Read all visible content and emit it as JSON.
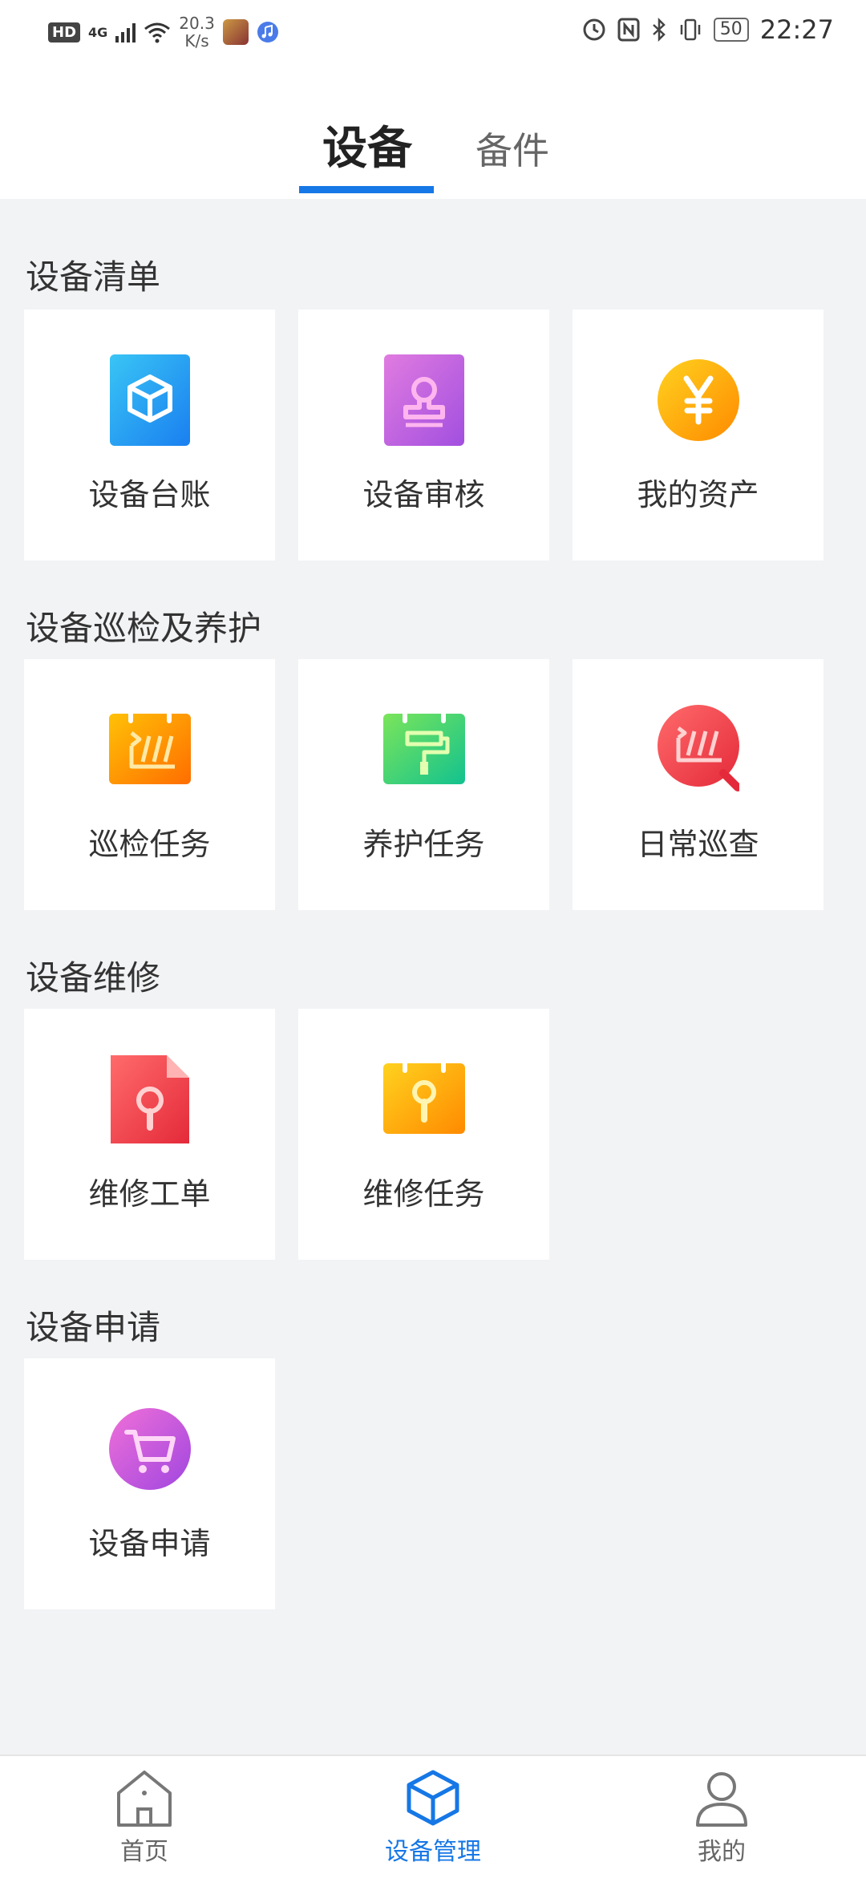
{
  "status_bar": {
    "hd": "HD",
    "network": "4G",
    "speed": "20.3",
    "speed_unit": "K/s",
    "battery": "50",
    "time": "22:27"
  },
  "tabs": [
    {
      "label": "设备",
      "active": true
    },
    {
      "label": "备件",
      "active": false
    }
  ],
  "sections": [
    {
      "title": "设备清单",
      "items": [
        {
          "label": "设备台账",
          "icon": "cube-icon"
        },
        {
          "label": "设备审核",
          "icon": "stamp-icon"
        },
        {
          "label": "我的资产",
          "icon": "yuan-coin-icon"
        }
      ]
    },
    {
      "title": "设备巡检及养护",
      "items": [
        {
          "label": "巡检任务",
          "icon": "inspection-calendar-icon"
        },
        {
          "label": "养护任务",
          "icon": "maintenance-calendar-icon"
        },
        {
          "label": "日常巡查",
          "icon": "patrol-search-icon"
        }
      ]
    },
    {
      "title": "设备维修",
      "items": [
        {
          "label": "维修工单",
          "icon": "repair-document-icon"
        },
        {
          "label": "维修任务",
          "icon": "repair-calendar-icon"
        }
      ]
    },
    {
      "title": "设备申请",
      "items": [
        {
          "label": "设备申请",
          "icon": "cart-icon"
        }
      ]
    }
  ],
  "bottom_nav": [
    {
      "label": "首页",
      "icon": "home-icon",
      "active": false
    },
    {
      "label": "设备管理",
      "icon": "cube-outline-icon",
      "active": true
    },
    {
      "label": "我的",
      "icon": "user-icon",
      "active": false
    }
  ],
  "colors": {
    "accent": "#1677e6",
    "background": "#f2f3f5",
    "card": "#ffffff"
  }
}
